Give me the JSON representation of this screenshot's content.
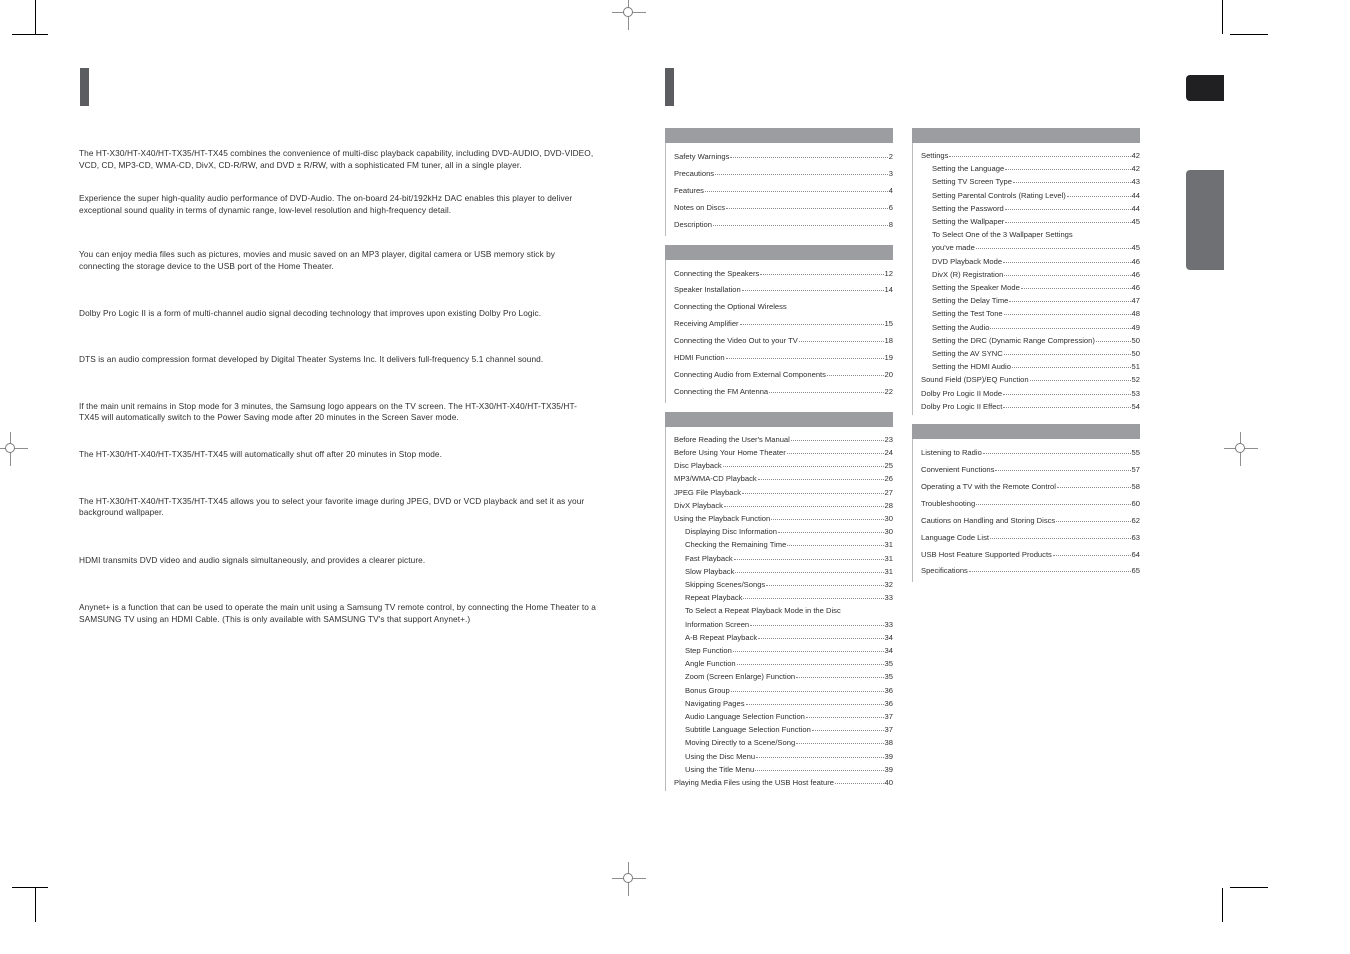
{
  "document": {
    "type": "printed-manual-spread",
    "colors": {
      "header_bar": "#9b9da0",
      "chapter_rule": "#5b5d60",
      "tab_black": "#201f21",
      "tab_grey": "#6e7073",
      "text": "#2f2f2f"
    }
  },
  "left_column": {
    "paragraphs": [
      "The HT-X30/HT-X40/HT-TX35/HT-TX45 combines the convenience of multi-disc playback capability, including DVD-AUDIO, DVD-VIDEO, VCD, CD, MP3-CD, WMA-CD, DivX, CD-R/RW, and DVD ± R/RW, with a sophisticated FM tuner, all in a single player.",
      "Experience the super high-quality audio performance of DVD-Audio.\nThe on-board 24-bit/192kHz DAC enables this player to deliver exceptional sound quality in terms of dynamic range, low-level resolution and high-frequency detail.",
      "You can enjoy media files such as pictures, movies and music saved on an MP3 player, digital camera or USB memory stick by connecting the storage device to the USB port of the Home Theater.",
      "Dolby Pro Logic II is a form of multi-channel audio signal decoding technology that improves upon existing  Dolby Pro Logic.",
      "DTS is an audio compression format developed by Digital Theater Systems Inc. It delivers full-frequency\n5.1 channel sound.",
      "If the main unit remains in Stop mode for 3 minutes, the Samsung logo appears on the TV screen.\nThe HT-X30/HT-X40/HT-TX35/HT-TX45 will automatically switch to the Power Saving mode after 20 minutes in the Screen Saver mode.",
      "The HT-X30/HT-X40/HT-TX35/HT-TX45 will automatically shut off after 20 minutes in Stop mode.",
      "The HT-X30/HT-X40/HT-TX35/HT-TX45 allows you to select your favorite image during JPEG, DVD or VCD playback and set it as your background wallpaper.",
      "HDMI transmits DVD video and audio signals simultaneously, and provides a clearer picture.",
      "Anynet+ is a function that can be used to operate the main unit using a Samsung TV remote control, by connecting the Home Theater to a SAMSUNG TV using an HDMI Cable. (This is only available with SAMSUNG TV's that support Anynet+.)"
    ]
  },
  "toc": {
    "middle_column": [
      {
        "header": "",
        "spacing": "wide",
        "entries": [
          {
            "label": "Safety Warnings",
            "page": "2",
            "indent": false,
            "dots": true
          },
          {
            "label": "Precautions",
            "page": "3",
            "indent": false,
            "dots": true
          },
          {
            "label": "Features",
            "page": "4",
            "indent": false,
            "dots": true
          },
          {
            "label": "Notes on Discs",
            "page": "6",
            "indent": false,
            "dots": true
          },
          {
            "label": "Description",
            "page": "8",
            "indent": false,
            "dots": true
          }
        ]
      },
      {
        "header": "",
        "spacing": "wide",
        "entries": [
          {
            "label": "Connecting the Speakers",
            "page": "12",
            "indent": false,
            "dots": true
          },
          {
            "label": "Speaker Installation",
            "page": "14",
            "indent": false,
            "dots": true
          },
          {
            "label": "Connecting the Optional Wireless",
            "page": "",
            "indent": false,
            "dots": false
          },
          {
            "label": "Receiving Amplifier",
            "page": "15",
            "indent": false,
            "dots": true
          },
          {
            "label": "Connecting the Video Out to your TV",
            "page": "18",
            "indent": false,
            "dots": true
          },
          {
            "label": "HDMI Function",
            "page": "19",
            "indent": false,
            "dots": true
          },
          {
            "label": "Connecting Audio from External Components",
            "page": "20",
            "indent": false,
            "dots": true
          },
          {
            "label": "Connecting the FM Antenna",
            "page": "22",
            "indent": false,
            "dots": true
          }
        ]
      },
      {
        "header": "",
        "spacing": "normal",
        "entries": [
          {
            "label": "Before Reading the User's Manual",
            "page": "23",
            "indent": false,
            "dots": true
          },
          {
            "label": "Before Using Your Home Theater",
            "page": "24",
            "indent": false,
            "dots": true
          },
          {
            "label": "Disc Playback",
            "page": "25",
            "indent": false,
            "dots": true
          },
          {
            "label": "MP3/WMA-CD Playback",
            "page": "26",
            "indent": false,
            "dots": true
          },
          {
            "label": "JPEG File Playback",
            "page": "27",
            "indent": false,
            "dots": true
          },
          {
            "label": "DivX Playback",
            "page": "28",
            "indent": false,
            "dots": true
          },
          {
            "label": "Using the Playback Function",
            "page": "30",
            "indent": false,
            "dots": true
          },
          {
            "label": "Displaying Disc Information",
            "page": "30",
            "indent": true,
            "dots": true
          },
          {
            "label": "Checking the Remaining Time",
            "page": "31",
            "indent": true,
            "dots": true
          },
          {
            "label": "Fast Playback",
            "page": "31",
            "indent": true,
            "dots": true
          },
          {
            "label": "Slow Playback",
            "page": "31",
            "indent": true,
            "dots": true
          },
          {
            "label": "Skipping Scenes/Songs",
            "page": "32",
            "indent": true,
            "dots": true
          },
          {
            "label": "Repeat Playback",
            "page": "33",
            "indent": true,
            "dots": true
          },
          {
            "label": "To Select a Repeat Playback Mode in the Disc",
            "page": "",
            "indent": true,
            "dots": false
          },
          {
            "label": "Information Screen",
            "page": "33",
            "indent": true,
            "dots": true
          },
          {
            "label": "A-B Repeat Playback",
            "page": "34",
            "indent": true,
            "dots": true
          },
          {
            "label": "Step Function",
            "page": "34",
            "indent": true,
            "dots": true
          },
          {
            "label": "Angle Function",
            "page": "35",
            "indent": true,
            "dots": true
          },
          {
            "label": "Zoom (Screen Enlarge) Function",
            "page": "35",
            "indent": true,
            "dots": true
          },
          {
            "label": "Bonus Group",
            "page": "36",
            "indent": true,
            "dots": true
          },
          {
            "label": "Navigating Pages",
            "page": "36",
            "indent": true,
            "dots": true
          },
          {
            "label": "Audio Language Selection Function",
            "page": "37",
            "indent": true,
            "dots": true
          },
          {
            "label": "Subtitle Language Selection Function",
            "page": "37",
            "indent": true,
            "dots": true
          },
          {
            "label": "Moving Directly to a Scene/Song",
            "page": "38",
            "indent": true,
            "dots": true
          },
          {
            "label": "Using the Disc Menu",
            "page": "39",
            "indent": true,
            "dots": true
          },
          {
            "label": "Using the Title Menu",
            "page": "39",
            "indent": true,
            "dots": true
          },
          {
            "label": "Playing Media Files using the USB Host feature",
            "page": "40",
            "indent": false,
            "dots": true
          }
        ]
      }
    ],
    "right_column": [
      {
        "header": "",
        "spacing": "normal",
        "entries": [
          {
            "label": "Settings",
            "page": "42",
            "indent": false,
            "dots": true
          },
          {
            "label": "Setting the Language",
            "page": "42",
            "indent": true,
            "dots": true
          },
          {
            "label": "Setting TV Screen Type",
            "page": "43",
            "indent": true,
            "dots": true
          },
          {
            "label": "Setting Parental Controls (Rating Level)",
            "page": "44",
            "indent": true,
            "dots": true
          },
          {
            "label": "Setting the Password",
            "page": "44",
            "indent": true,
            "dots": true
          },
          {
            "label": "Setting the Wallpaper",
            "page": "45",
            "indent": true,
            "dots": true
          },
          {
            "label": "To Select One of the 3 Wallpaper Settings",
            "page": "",
            "indent": true,
            "dots": false
          },
          {
            "label": "you've made",
            "page": "45",
            "indent": true,
            "dots": true
          },
          {
            "label": "DVD Playback Mode",
            "page": "46",
            "indent": true,
            "dots": true
          },
          {
            "label": "DivX (R) Registration",
            "page": "46",
            "indent": true,
            "dots": true
          },
          {
            "label": "Setting the Speaker Mode",
            "page": "46",
            "indent": true,
            "dots": true
          },
          {
            "label": "Setting the Delay Time",
            "page": "47",
            "indent": true,
            "dots": true
          },
          {
            "label": "Setting the Test Tone",
            "page": "48",
            "indent": true,
            "dots": true
          },
          {
            "label": "Setting the Audio",
            "page": "49",
            "indent": true,
            "dots": true
          },
          {
            "label": "Setting the DRC (Dynamic Range Compression)",
            "page": "50",
            "indent": true,
            "dots": true
          },
          {
            "label": "Setting the AV SYNC",
            "page": "50",
            "indent": true,
            "dots": true
          },
          {
            "label": "Setting the HDMI Audio",
            "page": "51",
            "indent": true,
            "dots": true
          },
          {
            "label": "Sound Field (DSP)/EQ Function",
            "page": "52",
            "indent": false,
            "dots": true
          },
          {
            "label": "Dolby Pro Logic II Mode",
            "page": "53",
            "indent": false,
            "dots": true
          },
          {
            "label": "Dolby Pro Logic II Effect",
            "page": "54",
            "indent": false,
            "dots": true
          }
        ]
      },
      {
        "header": "",
        "spacing": "wide",
        "entries": [
          {
            "label": "Listening to Radio",
            "page": "55",
            "indent": false,
            "dots": true
          },
          {
            "label": "Convenient Functions",
            "page": "57",
            "indent": false,
            "dots": true
          },
          {
            "label": "Operating a TV with the Remote Control",
            "page": "58",
            "indent": false,
            "dots": true
          },
          {
            "label": "Troubleshooting",
            "page": "60",
            "indent": false,
            "dots": true
          },
          {
            "label": "Cautions on Handling and Storing Discs",
            "page": "62",
            "indent": false,
            "dots": true
          },
          {
            "label": "Language Code List",
            "page": "63",
            "indent": false,
            "dots": true
          },
          {
            "label": "USB Host Feature Supported Products",
            "page": "64",
            "indent": false,
            "dots": true
          },
          {
            "label": "Specifications",
            "page": "65",
            "indent": false,
            "dots": true
          }
        ]
      }
    ]
  }
}
